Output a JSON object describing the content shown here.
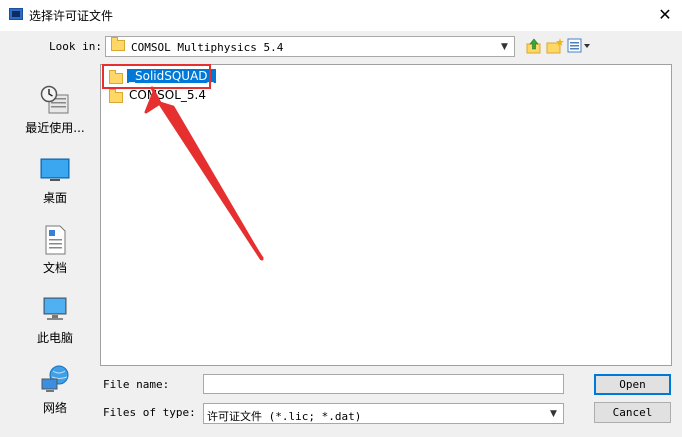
{
  "window": {
    "title": "选择许可证文件",
    "close_glyph": "✕"
  },
  "look_in": {
    "label": "Look in:",
    "value": "COMSOL Multiphysics 5.4"
  },
  "places": [
    {
      "label": "最近使用...",
      "icon": "recent-icon"
    },
    {
      "label": "桌面",
      "icon": "desktop-icon"
    },
    {
      "label": "文档",
      "icon": "documents-icon"
    },
    {
      "label": "此电脑",
      "icon": "computer-icon"
    },
    {
      "label": "网络",
      "icon": "network-icon"
    }
  ],
  "files": [
    {
      "name": "_SolidSQUAD_",
      "selected": true
    },
    {
      "name": "COMSOL_5.4",
      "selected": false
    }
  ],
  "file_name": {
    "label": "File name:",
    "value": ""
  },
  "files_of_type": {
    "label": "Files of type:",
    "value": "许可证文件 (*.lic; *.dat)"
  },
  "buttons": {
    "open": "Open",
    "cancel": "Cancel"
  },
  "colors": {
    "selection": "#0078d7",
    "annotation": "#e62f2f",
    "folder": "#ffd766"
  }
}
